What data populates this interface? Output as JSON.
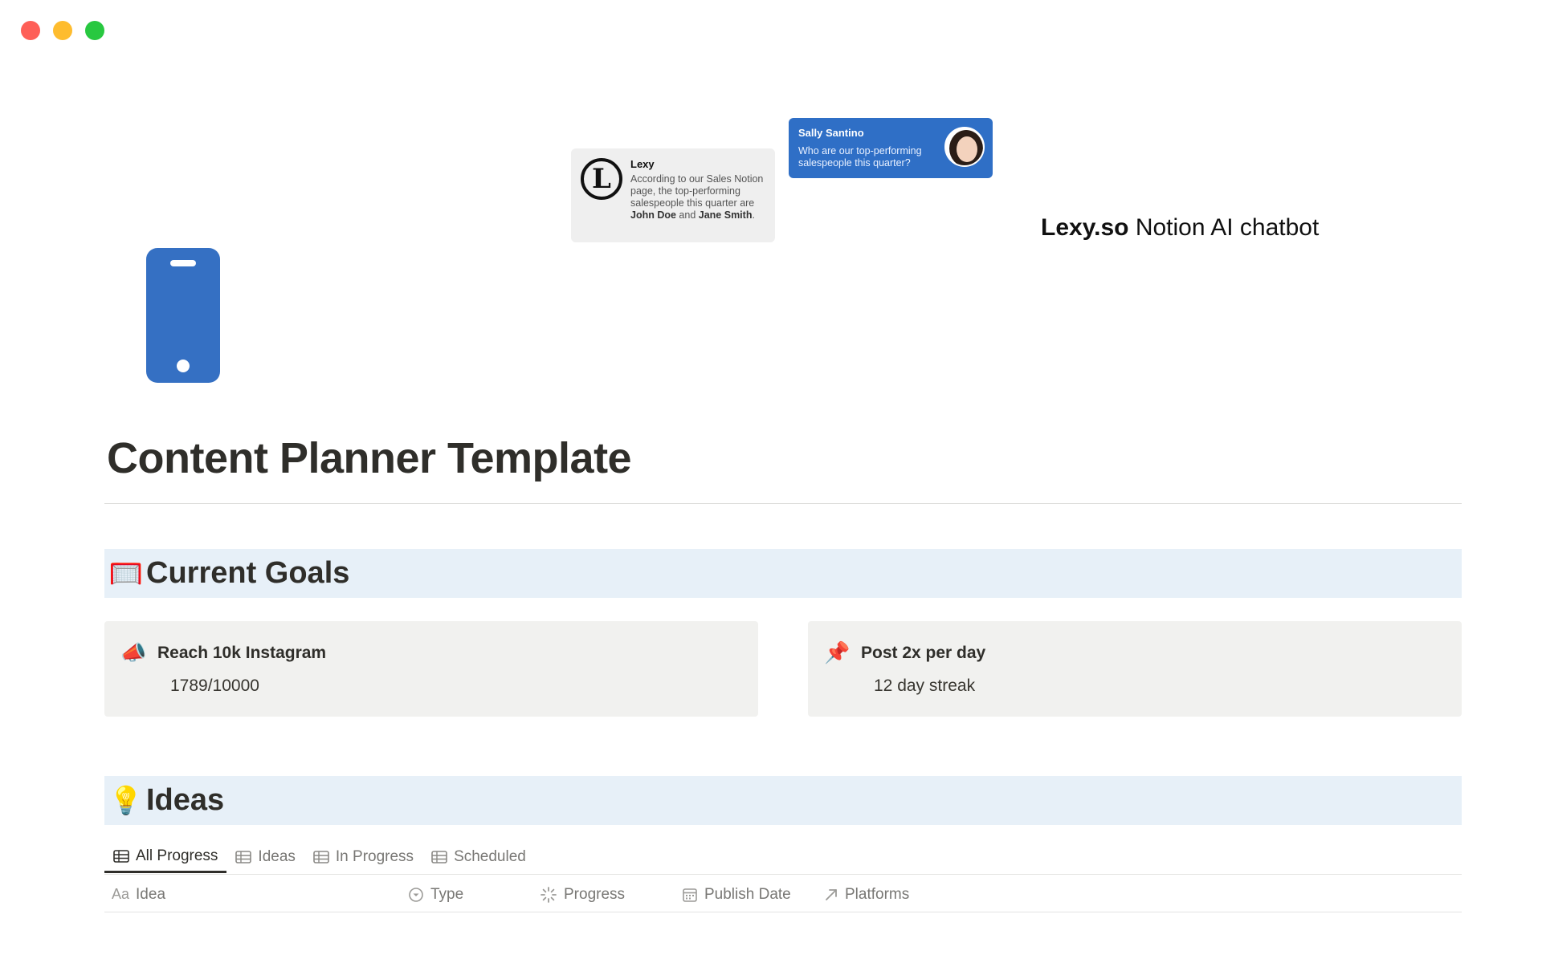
{
  "window": {
    "controls": [
      "close",
      "minimize",
      "zoom"
    ]
  },
  "cover": {
    "lexy_bubble": {
      "name": "Lexy",
      "message_part1": "According to our Sales Notion page, the top-performing salespeople this quarter are ",
      "person1": "John Doe",
      "message_part2": " and ",
      "person2": "Jane Smith",
      "message_part3": "."
    },
    "sally_bubble": {
      "name": "Sally Santino",
      "message": "Who are our top-performing salespeople this quarter?"
    },
    "caption_brand": "Lexy.so",
    "caption_rest": " Notion AI chatbot",
    "logo_letter": "L"
  },
  "page": {
    "icon": "mobile-phone-icon",
    "title": "Content Planner Template"
  },
  "sections": {
    "goals": {
      "emoji": "🥅",
      "title": "Current Goals"
    },
    "ideas": {
      "emoji": "💡",
      "title": "Ideas"
    }
  },
  "goals": [
    {
      "emoji": "📣",
      "title": "Reach 10k Instagram",
      "value": "1789/10000"
    },
    {
      "emoji": "📌",
      "title": "Post 2x per day",
      "value": "12 day streak"
    }
  ],
  "views": [
    {
      "label": "All Progress",
      "active": true
    },
    {
      "label": "Ideas",
      "active": false
    },
    {
      "label": "In Progress",
      "active": false
    },
    {
      "label": "Scheduled",
      "active": false
    }
  ],
  "columns": [
    {
      "icon": "Aa",
      "label": "Idea"
    },
    {
      "icon": "select-icon",
      "label": "Type"
    },
    {
      "icon": "status-icon",
      "label": "Progress"
    },
    {
      "icon": "calendar-icon",
      "label": "Publish Date"
    },
    {
      "icon": "relation-arrow-icon",
      "label": "Platforms"
    }
  ],
  "colors": {
    "accent_blue": "#2f6fc6",
    "phone_blue": "#3570c3",
    "heading_bg": "#e7f0f8",
    "card_bg": "#f1f1ef"
  }
}
